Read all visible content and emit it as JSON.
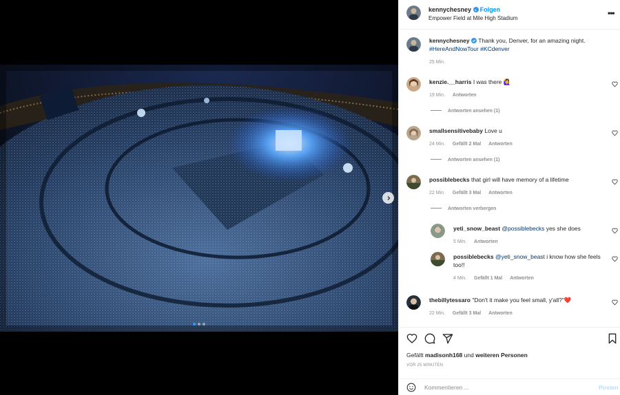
{
  "post": {
    "username": "kennychesney",
    "follow_label": "Folgen",
    "location": "Empower Field at Mile High Stadium",
    "more_icon": "more-options-icon",
    "caption": {
      "username": "kennychesney",
      "text": "Thank you, Denver, for an amazing night.",
      "hashtags": "#HereAndNowTour #KCdenver",
      "time": "25 Min."
    },
    "media": {
      "description_icon": "stadium-photo",
      "carousel_count": 3,
      "carousel_active": 1
    }
  },
  "comments": [
    {
      "username": "kenzie.__harris",
      "text": "I was there 🙋‍♀️",
      "time": "19 Min.",
      "likes": "",
      "reply_label": "Antworten",
      "replies_toggle": "Antworten ansehen (1)"
    },
    {
      "username": "smallsensitivebaby",
      "text": "Love u",
      "time": "24 Min.",
      "likes": "Gefällt 2 Mal",
      "reply_label": "Antworten",
      "replies_toggle": "Antworten ansehen (1)"
    },
    {
      "username": "possiblebecks",
      "text": "that girl will have memory of a lifetime",
      "time": "22 Min.",
      "likes": "Gefällt 3 Mal",
      "reply_label": "Antworten",
      "replies_toggle": "Antworten verbergen",
      "replies": [
        {
          "username": "yeti_snow_beast",
          "mention": "@possiblebecks",
          "text": "yes she does",
          "time": "5 Min.",
          "likes": "",
          "reply_label": "Antworten"
        },
        {
          "username": "possiblebecks",
          "mention": "@yeti_snow_beast",
          "text": "i know how she feels too!!",
          "time": "4 Min.",
          "likes": "Gefällt 1 Mal",
          "reply_label": "Antworten"
        }
      ]
    },
    {
      "username": "thebillytessaro",
      "text": "\"Don't it make you feel small, y'all?\"❤️",
      "time": "22 Min.",
      "likes": "Gefällt 3 Mal",
      "reply_label": "Antworten"
    }
  ],
  "footer": {
    "likes_prefix": "Gefällt",
    "likes_user": "madisonh168",
    "likes_mid": "und",
    "likes_others": "weiteren Personen",
    "time_ago": "VOR 25 MINUTEN",
    "comment_placeholder": "Kommentieren ...",
    "post_label": "Posten"
  },
  "colors": {
    "accent": "#0095f6",
    "verified": "#3897f0",
    "post_disabled": "#b2dffc",
    "heart_red": "#ed4956"
  }
}
